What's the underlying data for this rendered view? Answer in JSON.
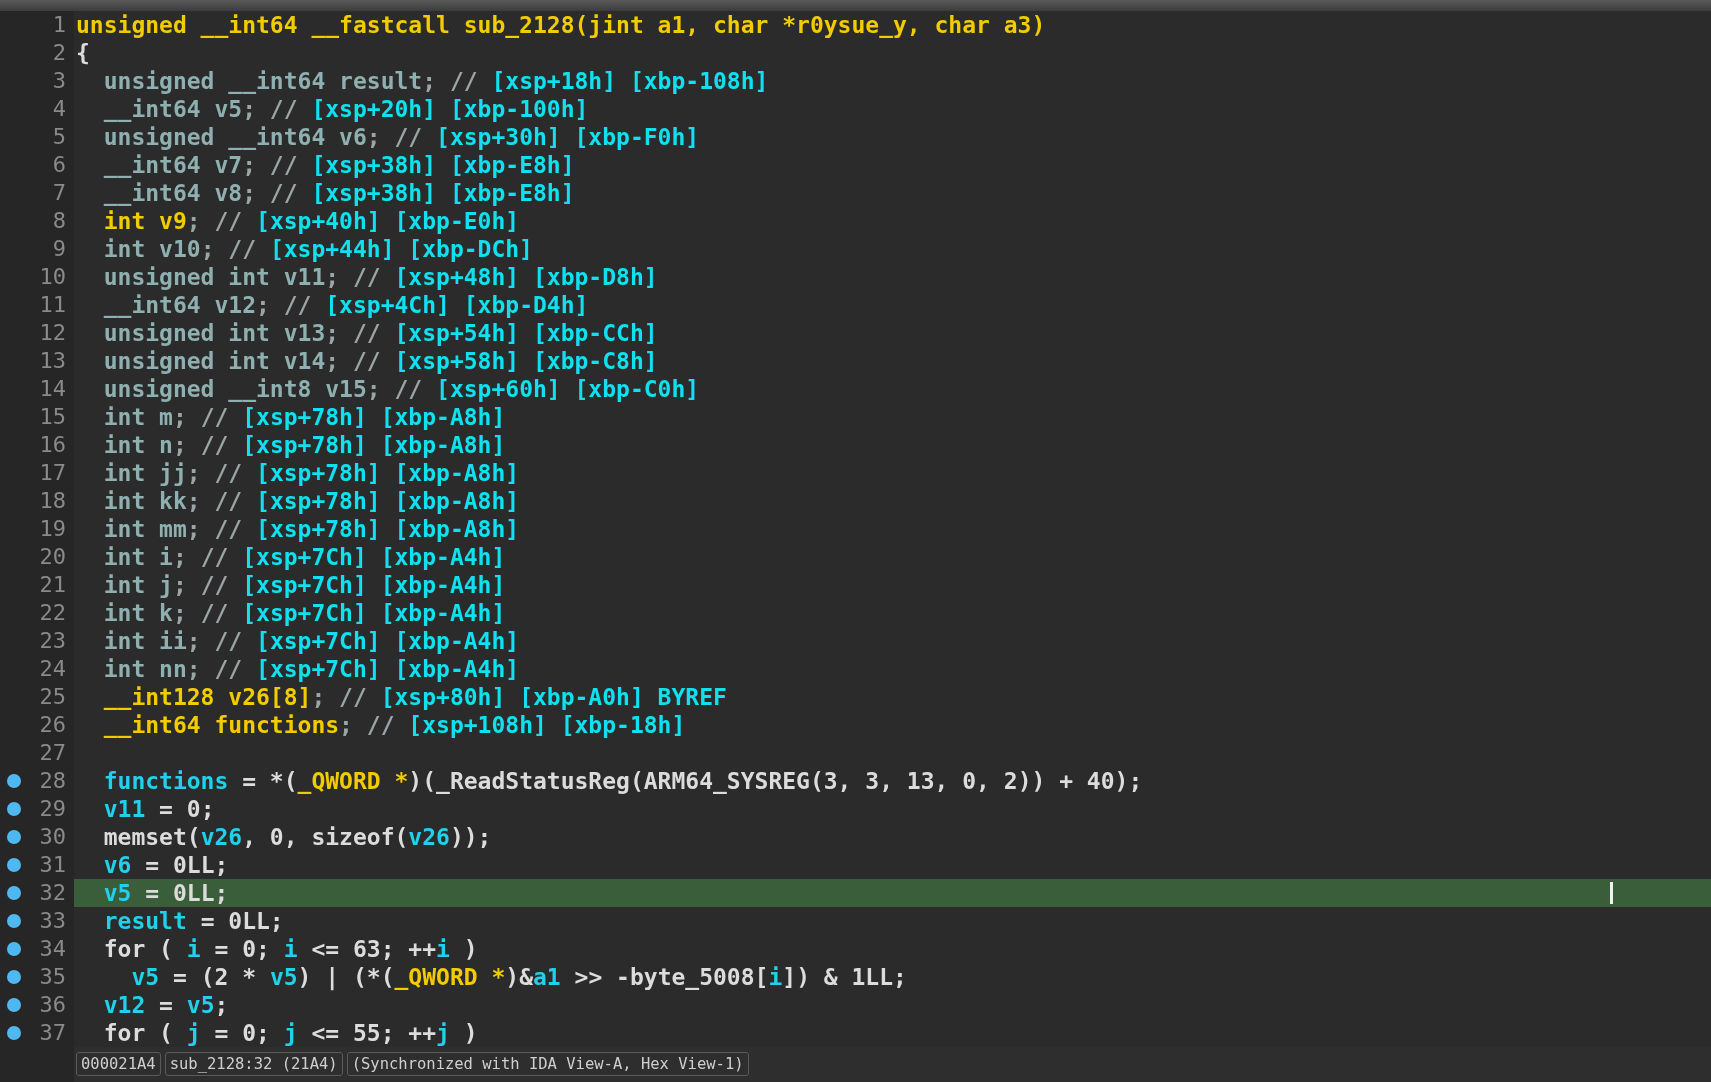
{
  "lines": [
    {
      "number": "1",
      "breakpoint": false,
      "selected": false,
      "tokens": [
        {
          "kind": "type",
          "text": "unsigned __int64 __fastcall sub_2128(jint a1, char *r0ysue_y, char a3)"
        }
      ]
    },
    {
      "number": "2",
      "breakpoint": false,
      "selected": false,
      "tokens": [
        {
          "kind": "text",
          "text": "{"
        }
      ]
    },
    {
      "number": "3",
      "breakpoint": false,
      "selected": false,
      "tokens": [
        {
          "kind": "decl",
          "text": "  unsigned __int64 result"
        },
        {
          "kind": "comment",
          "text": "; // "
        },
        {
          "kind": "offset",
          "text": "[xsp+18h] [xbp-108h]"
        }
      ]
    },
    {
      "number": "4",
      "breakpoint": false,
      "selected": false,
      "tokens": [
        {
          "kind": "decl",
          "text": "  __int64 v5"
        },
        {
          "kind": "comment",
          "text": "; // "
        },
        {
          "kind": "offset",
          "text": "[xsp+20h] [xbp-100h]"
        }
      ]
    },
    {
      "number": "5",
      "breakpoint": false,
      "selected": false,
      "tokens": [
        {
          "kind": "decl",
          "text": "  unsigned __int64 v6"
        },
        {
          "kind": "comment",
          "text": "; // "
        },
        {
          "kind": "offset",
          "text": "[xsp+30h] [xbp-F0h]"
        }
      ]
    },
    {
      "number": "6",
      "breakpoint": false,
      "selected": false,
      "tokens": [
        {
          "kind": "decl",
          "text": "  __int64 v7"
        },
        {
          "kind": "comment",
          "text": "; // "
        },
        {
          "kind": "offset",
          "text": "[xsp+38h] [xbp-E8h]"
        }
      ]
    },
    {
      "number": "7",
      "breakpoint": false,
      "selected": false,
      "tokens": [
        {
          "kind": "decl",
          "text": "  __int64 v8"
        },
        {
          "kind": "comment",
          "text": "; // "
        },
        {
          "kind": "offset",
          "text": "[xsp+38h] [xbp-E8h]"
        }
      ]
    },
    {
      "number": "8",
      "breakpoint": false,
      "selected": false,
      "tokens": [
        {
          "kind": "type",
          "text": "  int v9"
        },
        {
          "kind": "comment",
          "text": "; // "
        },
        {
          "kind": "offset",
          "text": "[xsp+40h] [xbp-E0h]"
        }
      ]
    },
    {
      "number": "9",
      "breakpoint": false,
      "selected": false,
      "tokens": [
        {
          "kind": "decl",
          "text": "  int v10"
        },
        {
          "kind": "comment",
          "text": "; // "
        },
        {
          "kind": "offset",
          "text": "[xsp+44h] [xbp-DCh]"
        }
      ]
    },
    {
      "number": "10",
      "breakpoint": false,
      "selected": false,
      "tokens": [
        {
          "kind": "decl",
          "text": "  unsigned int v11"
        },
        {
          "kind": "comment",
          "text": "; // "
        },
        {
          "kind": "offset",
          "text": "[xsp+48h] [xbp-D8h]"
        }
      ]
    },
    {
      "number": "11",
      "breakpoint": false,
      "selected": false,
      "tokens": [
        {
          "kind": "decl",
          "text": "  __int64 v12"
        },
        {
          "kind": "comment",
          "text": "; // "
        },
        {
          "kind": "offset",
          "text": "[xsp+4Ch] [xbp-D4h]"
        }
      ]
    },
    {
      "number": "12",
      "breakpoint": false,
      "selected": false,
      "tokens": [
        {
          "kind": "decl",
          "text": "  unsigned int v13"
        },
        {
          "kind": "comment",
          "text": "; // "
        },
        {
          "kind": "offset",
          "text": "[xsp+54h] [xbp-CCh]"
        }
      ]
    },
    {
      "number": "13",
      "breakpoint": false,
      "selected": false,
      "tokens": [
        {
          "kind": "decl",
          "text": "  unsigned int v14"
        },
        {
          "kind": "comment",
          "text": "; // "
        },
        {
          "kind": "offset",
          "text": "[xsp+58h] [xbp-C8h]"
        }
      ]
    },
    {
      "number": "14",
      "breakpoint": false,
      "selected": false,
      "tokens": [
        {
          "kind": "decl",
          "text": "  unsigned __int8 v15"
        },
        {
          "kind": "comment",
          "text": "; // "
        },
        {
          "kind": "offset",
          "text": "[xsp+60h] [xbp-C0h]"
        }
      ]
    },
    {
      "number": "15",
      "breakpoint": false,
      "selected": false,
      "tokens": [
        {
          "kind": "decl",
          "text": "  int m"
        },
        {
          "kind": "comment",
          "text": "; // "
        },
        {
          "kind": "offset",
          "text": "[xsp+78h] [xbp-A8h]"
        }
      ]
    },
    {
      "number": "16",
      "breakpoint": false,
      "selected": false,
      "tokens": [
        {
          "kind": "decl",
          "text": "  int n"
        },
        {
          "kind": "comment",
          "text": "; // "
        },
        {
          "kind": "offset",
          "text": "[xsp+78h] [xbp-A8h]"
        }
      ]
    },
    {
      "number": "17",
      "breakpoint": false,
      "selected": false,
      "tokens": [
        {
          "kind": "decl",
          "text": "  int jj"
        },
        {
          "kind": "comment",
          "text": "; // "
        },
        {
          "kind": "offset",
          "text": "[xsp+78h] [xbp-A8h]"
        }
      ]
    },
    {
      "number": "18",
      "breakpoint": false,
      "selected": false,
      "tokens": [
        {
          "kind": "decl",
          "text": "  int kk"
        },
        {
          "kind": "comment",
          "text": "; // "
        },
        {
          "kind": "offset",
          "text": "[xsp+78h] [xbp-A8h]"
        }
      ]
    },
    {
      "number": "19",
      "breakpoint": false,
      "selected": false,
      "tokens": [
        {
          "kind": "decl",
          "text": "  int mm"
        },
        {
          "kind": "comment",
          "text": "; // "
        },
        {
          "kind": "offset",
          "text": "[xsp+78h] [xbp-A8h]"
        }
      ]
    },
    {
      "number": "20",
      "breakpoint": false,
      "selected": false,
      "tokens": [
        {
          "kind": "decl",
          "text": "  int i"
        },
        {
          "kind": "comment",
          "text": "; // "
        },
        {
          "kind": "offset",
          "text": "[xsp+7Ch] [xbp-A4h]"
        }
      ]
    },
    {
      "number": "21",
      "breakpoint": false,
      "selected": false,
      "tokens": [
        {
          "kind": "decl",
          "text": "  int j"
        },
        {
          "kind": "comment",
          "text": "; // "
        },
        {
          "kind": "offset",
          "text": "[xsp+7Ch] [xbp-A4h]"
        }
      ]
    },
    {
      "number": "22",
      "breakpoint": false,
      "selected": false,
      "tokens": [
        {
          "kind": "decl",
          "text": "  int k"
        },
        {
          "kind": "comment",
          "text": "; // "
        },
        {
          "kind": "offset",
          "text": "[xsp+7Ch] [xbp-A4h]"
        }
      ]
    },
    {
      "number": "23",
      "breakpoint": false,
      "selected": false,
      "tokens": [
        {
          "kind": "decl",
          "text": "  int ii"
        },
        {
          "kind": "comment",
          "text": "; // "
        },
        {
          "kind": "offset",
          "text": "[xsp+7Ch] [xbp-A4h]"
        }
      ]
    },
    {
      "number": "24",
      "breakpoint": false,
      "selected": false,
      "tokens": [
        {
          "kind": "decl",
          "text": "  int nn"
        },
        {
          "kind": "comment",
          "text": "; // "
        },
        {
          "kind": "offset",
          "text": "[xsp+7Ch] [xbp-A4h]"
        }
      ]
    },
    {
      "number": "25",
      "breakpoint": false,
      "selected": false,
      "tokens": [
        {
          "kind": "type",
          "text": "  __int128 v26[8]"
        },
        {
          "kind": "comment",
          "text": "; // "
        },
        {
          "kind": "offset",
          "text": "[xsp+80h] [xbp-A0h] BYREF"
        }
      ]
    },
    {
      "number": "26",
      "breakpoint": false,
      "selected": false,
      "tokens": [
        {
          "kind": "type",
          "text": "  __int64 functions"
        },
        {
          "kind": "comment",
          "text": "; // "
        },
        {
          "kind": "offset",
          "text": "[xsp+108h] [xbp-18h]"
        }
      ]
    },
    {
      "number": "27",
      "breakpoint": false,
      "selected": false
    },
    {
      "number": "28",
      "breakpoint": true,
      "selected": false,
      "tokens": [
        {
          "kind": "var",
          "text": "  functions"
        },
        {
          "kind": "text",
          "text": " = *("
        },
        {
          "kind": "type",
          "text": "_QWORD *"
        },
        {
          "kind": "text",
          "text": ")(_ReadStatusReg(ARM64_SYSREG(3, 3, 13, 0, 2)) + 40);"
        }
      ]
    },
    {
      "number": "29",
      "breakpoint": true,
      "selected": false,
      "tokens": [
        {
          "kind": "var",
          "text": "  v11"
        },
        {
          "kind": "text",
          "text": " = 0;"
        }
      ]
    },
    {
      "number": "30",
      "breakpoint": true,
      "selected": false,
      "tokens": [
        {
          "kind": "text",
          "text": "  memset("
        },
        {
          "kind": "var",
          "text": "v26"
        },
        {
          "kind": "text",
          "text": ", 0, sizeof("
        },
        {
          "kind": "var",
          "text": "v26"
        },
        {
          "kind": "text",
          "text": "));"
        }
      ]
    },
    {
      "number": "31",
      "breakpoint": true,
      "selected": false,
      "tokens": [
        {
          "kind": "var",
          "text": "  v6"
        },
        {
          "kind": "text",
          "text": " = 0LL;"
        }
      ]
    },
    {
      "number": "32",
      "breakpoint": true,
      "selected": true,
      "tokens": [
        {
          "kind": "var",
          "text": "  v5"
        },
        {
          "kind": "text",
          "text": " = 0LL;"
        }
      ]
    },
    {
      "number": "33",
      "breakpoint": true,
      "selected": false,
      "tokens": [
        {
          "kind": "var",
          "text": "  result"
        },
        {
          "kind": "text",
          "text": " = 0LL;"
        }
      ]
    },
    {
      "number": "34",
      "breakpoint": true,
      "selected": false,
      "tokens": [
        {
          "kind": "text",
          "text": "  for ( "
        },
        {
          "kind": "var",
          "text": "i"
        },
        {
          "kind": "text",
          "text": " = 0; "
        },
        {
          "kind": "var",
          "text": "i"
        },
        {
          "kind": "text",
          "text": " <= 63; ++"
        },
        {
          "kind": "var",
          "text": "i"
        },
        {
          "kind": "text",
          "text": " )"
        }
      ]
    },
    {
      "number": "35",
      "breakpoint": true,
      "selected": false,
      "tokens": [
        {
          "kind": "var",
          "text": "    v5"
        },
        {
          "kind": "text",
          "text": " = (2 * "
        },
        {
          "kind": "var",
          "text": "v5"
        },
        {
          "kind": "text",
          "text": ") | (*("
        },
        {
          "kind": "type",
          "text": "_QWORD *"
        },
        {
          "kind": "text",
          "text": ")&"
        },
        {
          "kind": "var",
          "text": "a1"
        },
        {
          "kind": "text",
          "text": " >> -byte_5008["
        },
        {
          "kind": "var",
          "text": "i"
        },
        {
          "kind": "text",
          "text": "]) & 1LL;"
        }
      ]
    },
    {
      "number": "36",
      "breakpoint": true,
      "selected": false,
      "tokens": [
        {
          "kind": "var",
          "text": "  v12"
        },
        {
          "kind": "text",
          "text": " = "
        },
        {
          "kind": "var",
          "text": "v5"
        },
        {
          "kind": "text",
          "text": ";"
        }
      ]
    },
    {
      "number": "37",
      "breakpoint": true,
      "selected": false,
      "tokens": [
        {
          "kind": "text",
          "text": "  for ( "
        },
        {
          "kind": "var",
          "text": "j"
        },
        {
          "kind": "text",
          "text": " = 0; "
        },
        {
          "kind": "var",
          "text": "j"
        },
        {
          "kind": "text",
          "text": " <= 55; ++"
        },
        {
          "kind": "var",
          "text": "j"
        },
        {
          "kind": "text",
          "text": " )"
        }
      ]
    }
  ],
  "status_bar": [
    "000021A4",
    "sub_2128:32 (21A4)",
    "(Synchronized with IDA View-A, Hex View-1)"
  ]
}
